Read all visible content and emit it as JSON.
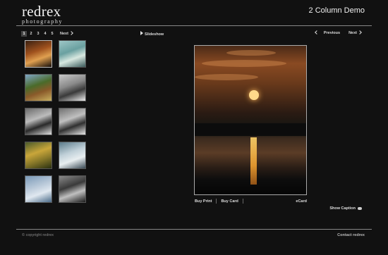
{
  "site": {
    "logo_main": "redrex",
    "logo_sub": "photography",
    "page_title": "2 Column Demo"
  },
  "pager": {
    "pages": [
      "1",
      "2",
      "3",
      "4",
      "5"
    ],
    "active": "1",
    "next_label": "Next"
  },
  "slideshow_label": "Slideshow",
  "image_nav": {
    "previous_label": "Previous",
    "next_label": "Next"
  },
  "thumbnails": [
    {
      "name": "thumb-sunset",
      "colors": [
        "#3a2010",
        "#a0521e",
        "#e0a050",
        "#150d08"
      ]
    },
    {
      "name": "thumb-rollercoaster",
      "colors": [
        "#9ec7c7",
        "#6aa0a0",
        "#d8e8e0",
        "#3a5a5a"
      ]
    },
    {
      "name": "thumb-barn-field",
      "colors": [
        "#7fa6c8",
        "#4a6b2a",
        "#8a5a2a",
        "#c8b060"
      ]
    },
    {
      "name": "thumb-snowy-trees",
      "colors": [
        "#c9c9c9",
        "#8a8a8a",
        "#3a3a3a",
        "#ececec"
      ]
    },
    {
      "name": "thumb-winter-trees-1",
      "colors": [
        "#6a6a6a",
        "#bcbcbc",
        "#2a2a2a",
        "#e0e0e0"
      ]
    },
    {
      "name": "thumb-winter-trees-2",
      "colors": [
        "#707070",
        "#c0c0c0",
        "#303030",
        "#e8e8e8"
      ]
    },
    {
      "name": "thumb-golden-field",
      "colors": [
        "#4a5a2a",
        "#c9a63a",
        "#8a7a2a",
        "#2a3010"
      ]
    },
    {
      "name": "thumb-frosted-tree",
      "colors": [
        "#5a7a8a",
        "#c0d0d8",
        "#e8eef0",
        "#3a4a55"
      ]
    },
    {
      "name": "thumb-snow-tree",
      "colors": [
        "#7a9ab8",
        "#b8c8d8",
        "#e0e8f0",
        "#4a6a88"
      ]
    },
    {
      "name": "thumb-big-ben",
      "colors": [
        "#8a8a8a",
        "#3a3a3a",
        "#c0c0c0",
        "#1a1a1a"
      ]
    }
  ],
  "photo_actions": {
    "buy_print": "Buy Print",
    "buy_card": "Buy Card",
    "ecard": "eCard"
  },
  "show_caption_label": "Show Caption",
  "footer": {
    "copyright": "© copyright redrex",
    "contact": "Contact redrex"
  }
}
